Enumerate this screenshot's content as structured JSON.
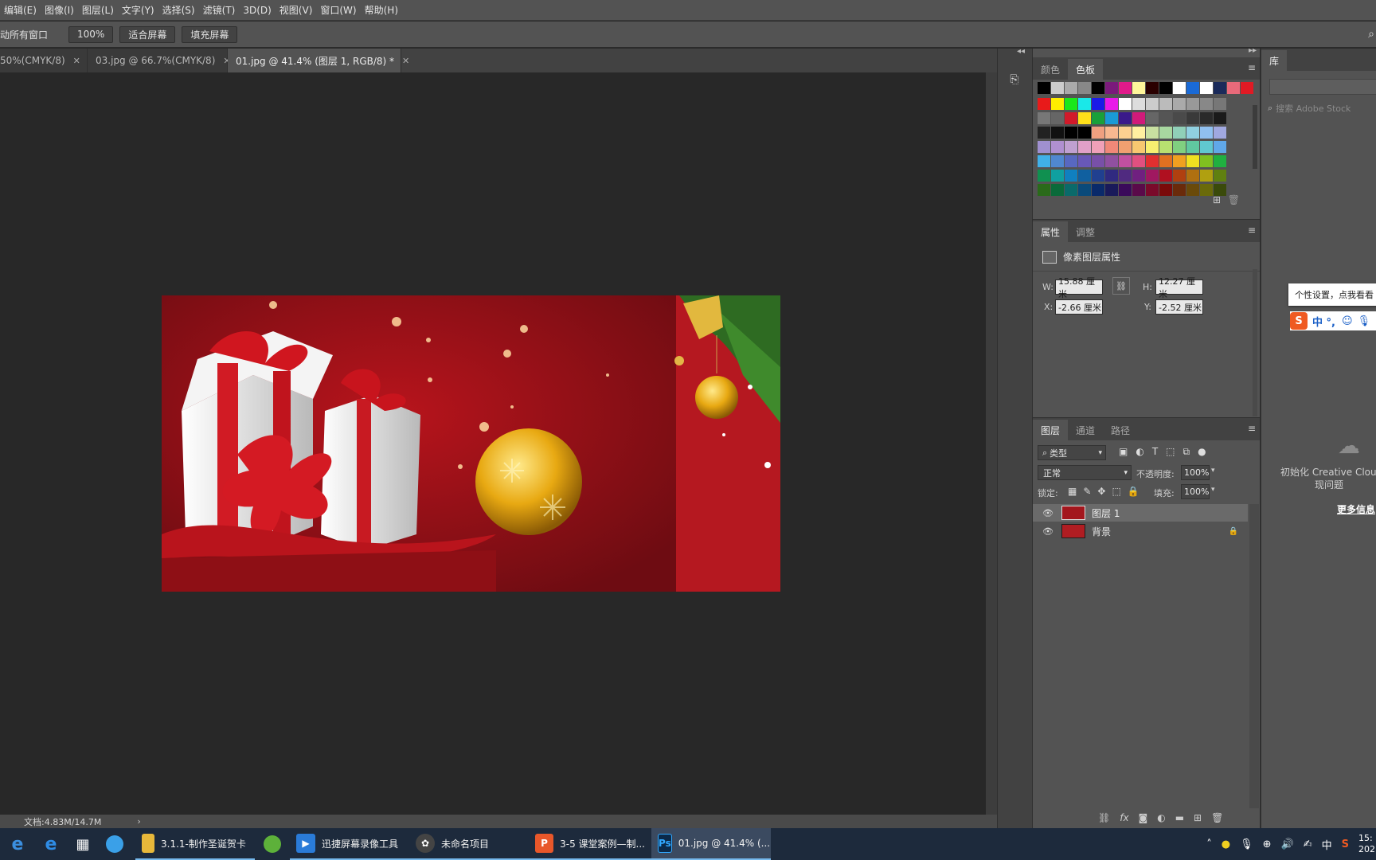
{
  "menu": [
    "编辑(E)",
    "图像(I)",
    "图层(L)",
    "文字(Y)",
    "选择(S)",
    "滤镜(T)",
    "3D(D)",
    "视图(V)",
    "窗口(W)",
    "帮助(H)"
  ],
  "options": {
    "scroll_all": "动所有窗口",
    "zoom_value": "100%",
    "fit_screen": "适合屏幕",
    "fill_screen": "填充屏幕"
  },
  "tabs": [
    {
      "label": "50%(CMYK/8)"
    },
    {
      "label": "03.jpg @ 66.7%(CMYK/8)"
    },
    {
      "label": "01.jpg @ 41.4% (图层 1, RGB/8) *"
    }
  ],
  "status": {
    "doc": "文档:4.83M/14.7M"
  },
  "swatches_panel": {
    "tab_color": "颜色",
    "tab_swatches": "色板"
  },
  "properties_panel": {
    "tab_properties": "属性",
    "tab_adjustments": "调整",
    "title": "像素图层属性",
    "w_label": "W:",
    "w_value": "15.88 厘米",
    "h_label": "H:",
    "h_value": "12.27 厘米",
    "x_label": "X:",
    "x_value": "-2.66 厘米",
    "y_label": "Y:",
    "y_value": "-2.52 厘米"
  },
  "layers_panel": {
    "tab_layers": "图层",
    "tab_channels": "通道",
    "tab_paths": "路径",
    "filter_kind": "类型",
    "blend_mode": "正常",
    "opacity_label": "不透明度:",
    "opacity_value": "100%",
    "lock_label": "锁定:",
    "fill_label": "填充:",
    "fill_value": "100%",
    "layers": [
      {
        "name": "图层 1"
      },
      {
        "name": "背景"
      }
    ]
  },
  "library": {
    "tab": "库",
    "search_placeholder": "搜索 Adobe Stock",
    "tooltip": "个性设置，点我看看",
    "ime_text": "中 °,",
    "cc_line1": "初始化 Creative Cloud",
    "cc_line2": "现问题",
    "more_info": "更多信息"
  },
  "taskbar": {
    "apps": [
      {
        "label": "3.1.1-制作圣诞贺卡",
        "color": "#e8b83a"
      },
      {
        "label": "迅捷屏幕录像工具",
        "color": "#2a7bd8"
      },
      {
        "label": "未命名项目",
        "color": "#444"
      },
      {
        "label": "3-5 课堂案例—制...",
        "color": "#e8572a"
      },
      {
        "label": "01.jpg @ 41.4% (...",
        "color": "#0b2a4a"
      }
    ],
    "tray_lang": "中",
    "clock_time": "15:",
    "clock_date": "202"
  },
  "colors": {
    "accent": "#76b9ed",
    "card_red": "#b01d22"
  }
}
